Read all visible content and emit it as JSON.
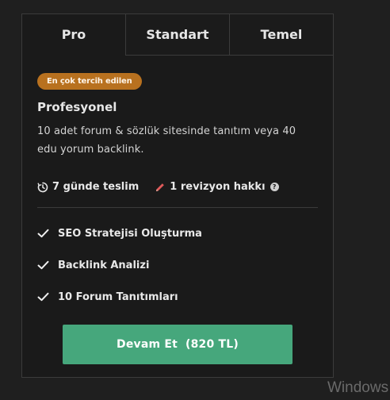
{
  "tabs": [
    {
      "label": "Pro",
      "active": true
    },
    {
      "label": "Standart",
      "active": false
    },
    {
      "label": "Temel",
      "active": false
    }
  ],
  "package": {
    "badge": "En çok tercih edilen",
    "title": "Profesyonel",
    "description": "10 adet forum & sözlük sitesinde tanıtım veya 40 edu yorum backlink.",
    "delivery": "7 günde teslim",
    "revisions": "1 revizyon hakkı",
    "help_icon": "?",
    "features": [
      "SEO Stratejisi Oluşturma",
      "Backlink Analizi",
      "10 Forum Tanıtımları"
    ],
    "cta_label": "Devam Et",
    "cta_price": "(820 TL)"
  },
  "watermark": "Windows",
  "colors": {
    "badge": "#b8711f",
    "cta": "#46a77c",
    "pencil": "#e05a5a",
    "background": "#1a1a1a"
  }
}
